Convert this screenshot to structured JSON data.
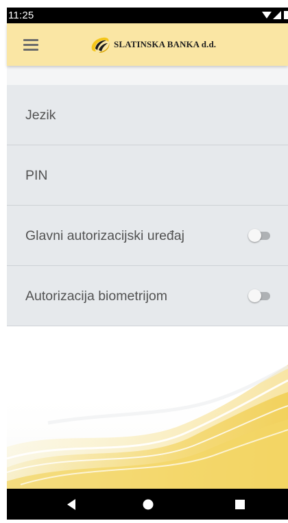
{
  "status_bar": {
    "time": "11:25",
    "icons": [
      "wifi-icon",
      "signal-icon",
      "battery-icon"
    ]
  },
  "app_bar": {
    "menu_icon": "hamburger-menu-icon",
    "logo_text": "SLATINSKA BANKA d.d.",
    "background_color": "#fae6a4"
  },
  "settings": {
    "items": [
      {
        "label": "Jezik"
      },
      {
        "label": "PIN"
      },
      {
        "label": "Glavni autorizacijski uređaj",
        "toggle": false
      },
      {
        "label": "Autorizacija biometrijom",
        "toggle": false
      }
    ]
  },
  "nav_bar": {
    "buttons": [
      "back-icon",
      "home-icon",
      "recents-icon"
    ]
  },
  "colors": {
    "accent": "#f5c61a",
    "list_background": "#e6e9ec",
    "text": "#525252"
  }
}
